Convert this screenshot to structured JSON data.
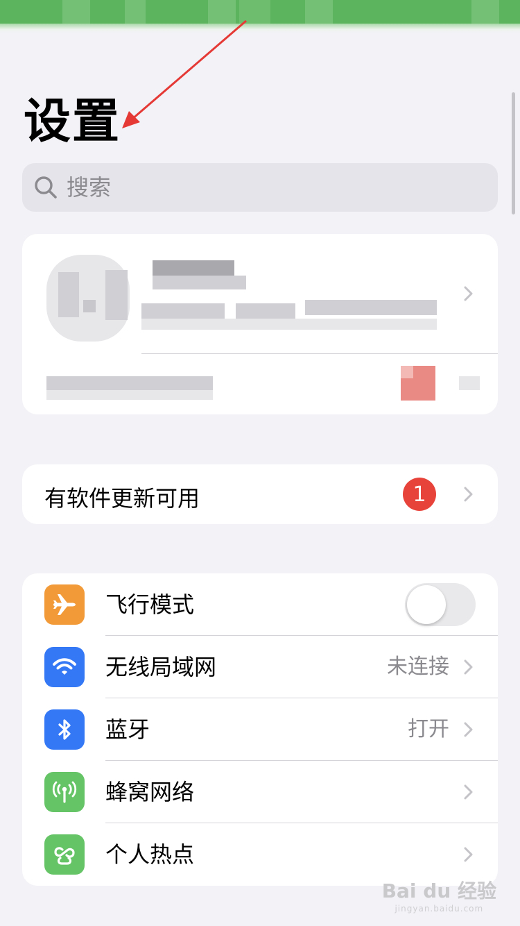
{
  "page_title": "设置",
  "search": {
    "placeholder": "搜索"
  },
  "update_row": {
    "label": "有软件更新可用",
    "badge": "1"
  },
  "network_rows": [
    {
      "label": "飞行模式",
      "icon": "airplane-icon",
      "icon_color": "#f19a37",
      "toggle_on": false
    },
    {
      "label": "无线局域网",
      "value": "未连接",
      "icon": "wifi-icon",
      "icon_color": "#3478f6"
    },
    {
      "label": "蓝牙",
      "value": "打开",
      "icon": "bluetooth-icon",
      "icon_color": "#3478f6"
    },
    {
      "label": "蜂窝网络",
      "icon": "cellular-icon",
      "icon_color": "#65c466"
    },
    {
      "label": "个人热点",
      "icon": "hotspot-icon",
      "icon_color": "#65c466"
    }
  ],
  "colors": {
    "background": "#f2f2f7",
    "badge": "#e8433a",
    "annotation_arrow": "#e53935"
  },
  "watermark": {
    "text": "Bai du 经验",
    "sub": "jingyan.baidu.com"
  }
}
